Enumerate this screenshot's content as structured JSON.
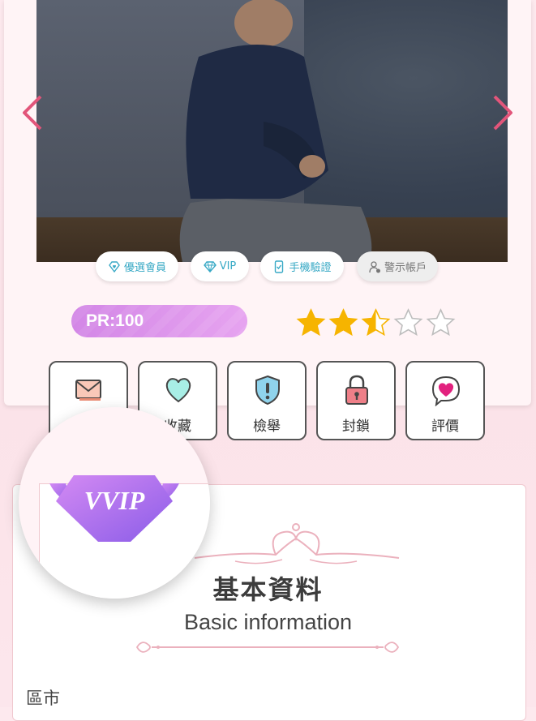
{
  "badges": [
    {
      "label": "優選會員",
      "icon": "diamond-heart-icon"
    },
    {
      "label": "VIP",
      "icon": "diamond-icon"
    },
    {
      "label": "手機驗證",
      "icon": "phone-check-icon"
    },
    {
      "label": "警示帳戶",
      "icon": "user-alert-icon"
    }
  ],
  "pr": {
    "label": "PR:100",
    "value": 100
  },
  "rating": {
    "value": 2.5,
    "max": 5
  },
  "actions": [
    {
      "label": "",
      "icon": "mail-icon"
    },
    {
      "label": "收藏",
      "icon": "heart-icon"
    },
    {
      "label": "檢舉",
      "icon": "shield-exclamation-icon"
    },
    {
      "label": "封鎖",
      "icon": "lock-icon"
    },
    {
      "label": "評價",
      "icon": "heart-chat-icon"
    }
  ],
  "vvip": {
    "label": "VVIP"
  },
  "info": {
    "title": "基本資料",
    "subtitle": "Basic information",
    "first_field_label": "區市"
  },
  "colors": {
    "accent_pink": "#e2557a",
    "badge_text": "#38a9c5",
    "pr_purple": "#cc7ce3",
    "star_gold": "#f6b400",
    "vvip_purple": "#a56af0"
  }
}
